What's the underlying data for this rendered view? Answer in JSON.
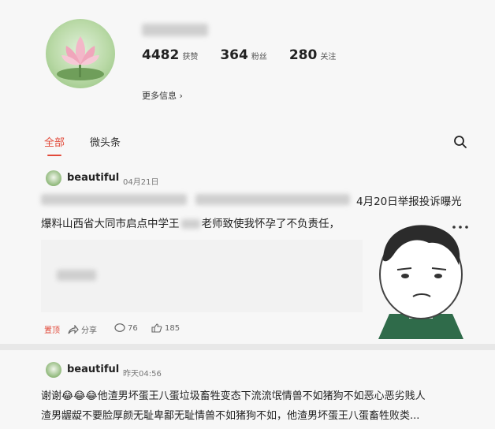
{
  "profile": {
    "stats": [
      {
        "num": "4482",
        "label": "获赞"
      },
      {
        "num": "364",
        "label": "粉丝"
      },
      {
        "num": "280",
        "label": "关注"
      }
    ],
    "more_info": "更多信息 ›"
  },
  "tabs": [
    "全部",
    "微头条"
  ],
  "posts": [
    {
      "author": "beautiful",
      "date": "04月21日",
      "line1": "4月20日举报投诉曝光",
      "line2": "爆料山西省大同市启点中学王",
      "line2b": "老师致使我怀孕了不负责任，",
      "actions": {
        "edit": "置顶",
        "share": "分享",
        "comments": "76",
        "likes": "185"
      }
    },
    {
      "author": "beautiful",
      "date": "昨天04:56",
      "line1": "谢谢😂😂😂他渣男坏蛋王八蛋垃圾畜牲变态下流流氓情兽不如猪狗不如恶心恶劣贱人",
      "line2": "渣男龌龊不要脸厚颜无耻卑鄙无耻情兽不如猪狗不如，他渣男坏蛋王八蛋畜牲败类..."
    }
  ],
  "colors": {
    "accent": "#e24a3a",
    "background": "#f7f7f7"
  }
}
